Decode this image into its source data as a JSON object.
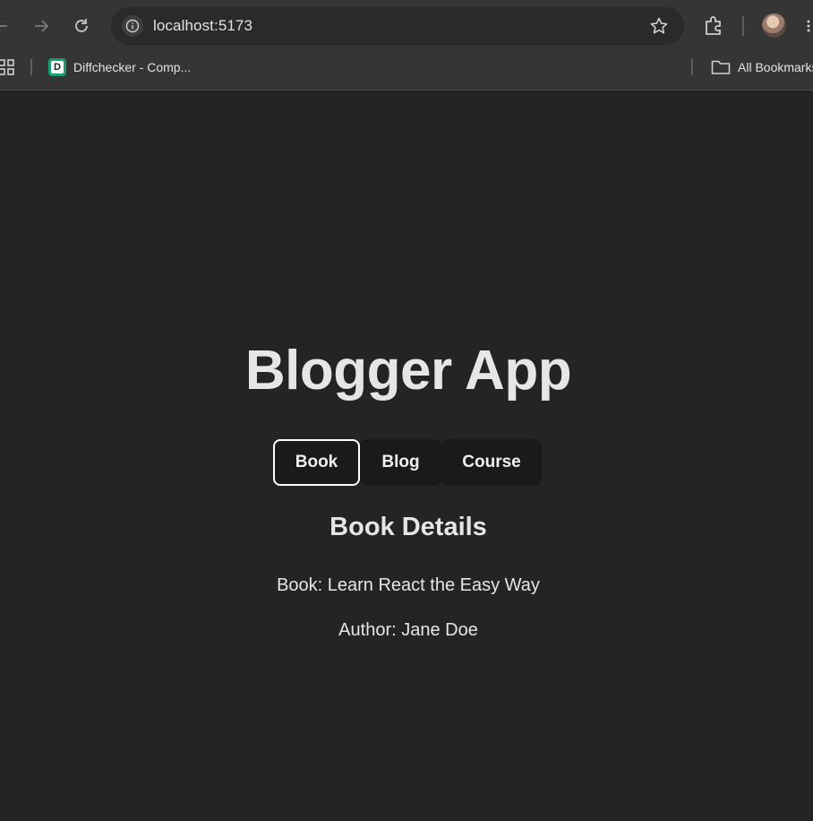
{
  "browser": {
    "url": "localhost:5173",
    "bookmarks": [
      {
        "label": "Diffchecker - Comp...",
        "favicon_letter": "D"
      }
    ],
    "all_bookmarks_label": "All Bookmarks"
  },
  "app": {
    "title": "Blogger App",
    "tabs": [
      {
        "label": "Book",
        "active": true
      },
      {
        "label": "Blog",
        "active": false
      },
      {
        "label": "Course",
        "active": false
      }
    ],
    "section_title": "Book Details",
    "book_line": "Book: Learn React the Easy Way",
    "author_line": "Author: Jane Doe"
  },
  "colors": {
    "page_background": "#242424",
    "browser_chrome": "#353535",
    "tab_background": "#1a1a1a",
    "active_tab_border": "#ffffff",
    "text": "#e6e6e6",
    "favicon_accent": "#1a9e6e"
  },
  "icons": [
    "back-arrow-icon",
    "forward-arrow-icon",
    "reload-icon",
    "info-icon",
    "star-icon",
    "extensions-icon",
    "apps-grid-icon",
    "folder-icon",
    "menu-dots-icon"
  ]
}
